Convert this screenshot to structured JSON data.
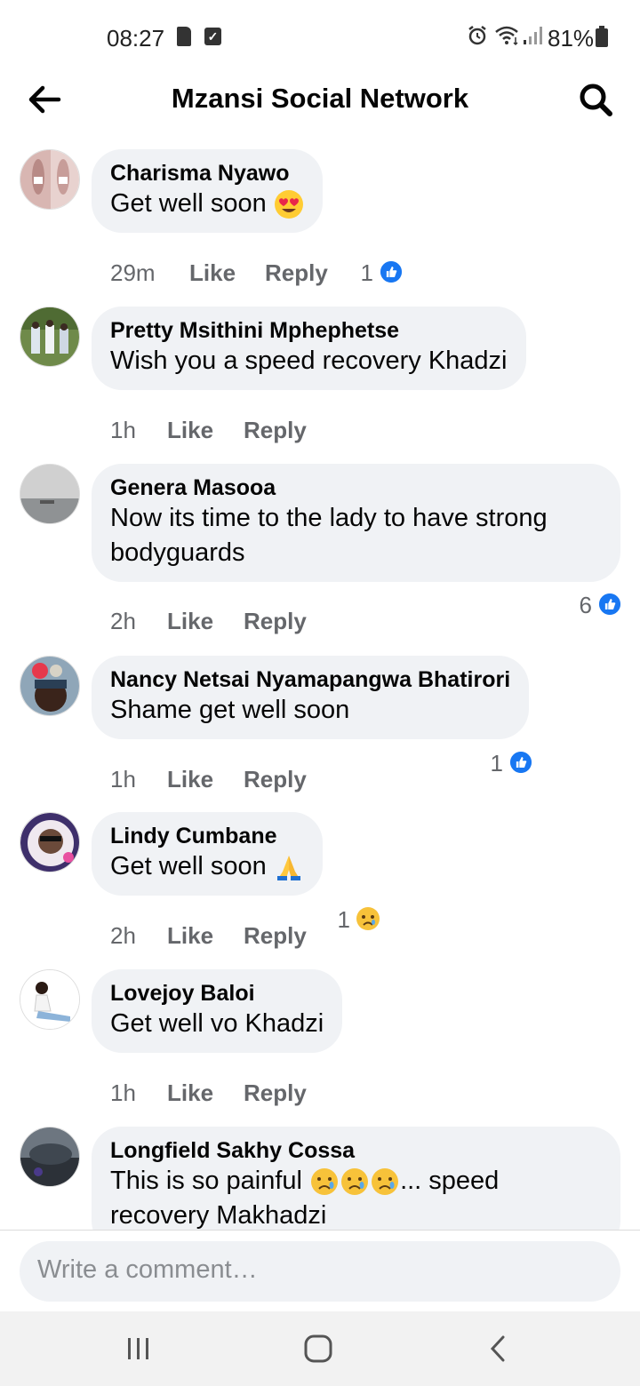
{
  "status_bar": {
    "time": "08:27",
    "battery": "81%"
  },
  "header": {
    "title": "Mzansi Social Network"
  },
  "comments": [
    {
      "name": "Charisma Nyawo",
      "text": "Get well soon",
      "emoji": "heart-eyes",
      "time": "29m",
      "like": "Like",
      "reply": "Reply",
      "reactions": "1",
      "reaction_type": "like"
    },
    {
      "name": "Pretty Msithini Mphephetse",
      "text": "Wish you a speed recovery Khadzi",
      "time": "1h",
      "like": "Like",
      "reply": "Reply"
    },
    {
      "name": "Genera Masooa",
      "text": "Now its time to the lady to have strong bodyguards",
      "time": "2h",
      "like": "Like",
      "reply": "Reply",
      "reactions": "6",
      "reaction_type": "like"
    },
    {
      "name": "Nancy Netsai Nyamapangwa Bhatirori",
      "text": "Shame get well soon",
      "time": "1h",
      "like": "Like",
      "reply": "Reply",
      "reactions": "1",
      "reaction_type": "like"
    },
    {
      "name": "Lindy Cumbane",
      "text": "Get well soon",
      "emoji": "folded-hands",
      "time": "2h",
      "like": "Like",
      "reply": "Reply",
      "reactions": "1",
      "reaction_type": "sad"
    },
    {
      "name": "Lovejoy Baloi",
      "text": "Get well vo Khadzi",
      "time": "1h",
      "like": "Like",
      "reply": "Reply"
    },
    {
      "name": "Longfield Sakhy Cossa",
      "text_before": "This is so painful",
      "text_after": "... speed",
      "text_line2": "recovery Makhadzi",
      "emoji": "sad-tear"
    }
  ],
  "composer": {
    "placeholder": "Write a comment…"
  },
  "colors": {
    "bubble": "#f0f2f5",
    "meta_text": "#65676b",
    "like_blue": "#1877f2"
  }
}
